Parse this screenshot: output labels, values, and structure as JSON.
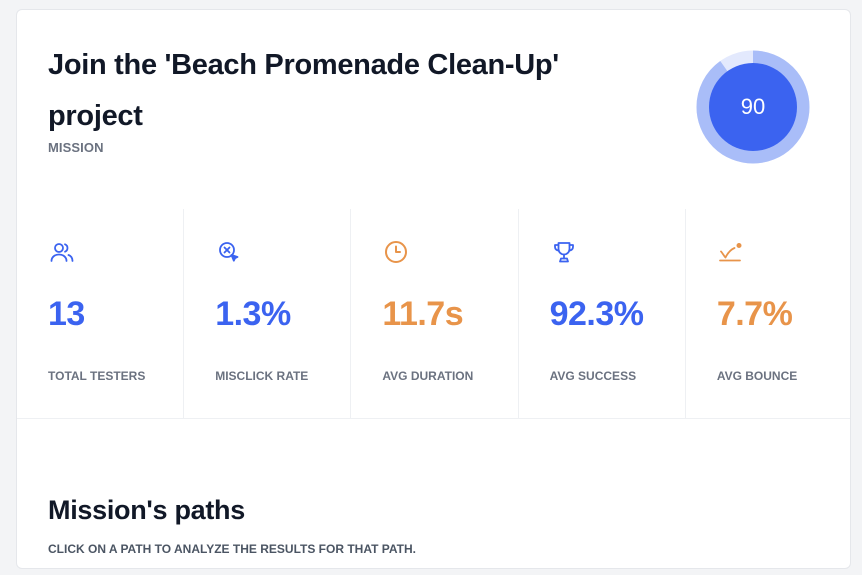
{
  "header": {
    "title": "Join the 'Beach Promenade Clean-Up' project",
    "subtitle": "MISSION",
    "score": "90",
    "score_fraction": 0.9
  },
  "colors": {
    "blue": "#3b63f0",
    "orange": "#e8944a",
    "ring": "#a9bdf8"
  },
  "stats": [
    {
      "icon": "users-icon",
      "value": "13",
      "label": "TOTAL TESTERS",
      "color": "#3b63f0"
    },
    {
      "icon": "misclick-icon",
      "value": "1.3%",
      "label": "MISCLICK RATE",
      "color": "#3b63f0"
    },
    {
      "icon": "clock-icon",
      "value": "11.7s",
      "label": "AVG DURATION",
      "color": "#e8944a"
    },
    {
      "icon": "trophy-icon",
      "value": "92.3%",
      "label": "AVG SUCCESS",
      "color": "#3b63f0"
    },
    {
      "icon": "bounce-icon",
      "value": "7.7%",
      "label": "AVG BOUNCE",
      "color": "#e8944a"
    }
  ],
  "paths": {
    "title": "Mission's paths",
    "subtitle": "CLICK ON A PATH TO ANALYZE THE RESULTS FOR THAT PATH."
  }
}
